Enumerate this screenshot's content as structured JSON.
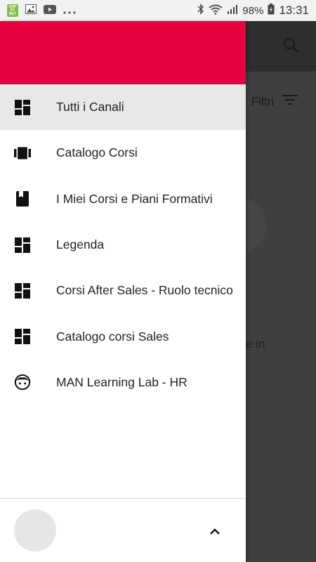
{
  "status_bar": {
    "happy_icon_text": "HAP PY BET",
    "battery_percent": "98%",
    "time": "13:31",
    "icons": [
      "happy-app-icon",
      "gallery-icon",
      "youtube-icon",
      "more-icon",
      "bluetooth-icon",
      "wifi-icon",
      "signal-icon",
      "battery-icon"
    ]
  },
  "background": {
    "filter_label": "Filtri",
    "partial_text": "e in"
  },
  "drawer": {
    "header_color": "#e5023d",
    "items": [
      {
        "label": "Tutti i Canali",
        "icon": "dashboard-icon",
        "active": true
      },
      {
        "label": "Catalogo Corsi",
        "icon": "carousel-icon",
        "active": false
      },
      {
        "label": "I Miei Corsi e Piani Formativi",
        "icon": "book-icon",
        "active": false
      },
      {
        "label": "Legenda",
        "icon": "dashboard-icon",
        "active": false
      },
      {
        "label": "Corsi After Sales - Ruolo tecnico",
        "icon": "dashboard-icon",
        "active": false
      },
      {
        "label": "Catalogo corsi Sales",
        "icon": "dashboard-icon",
        "active": false
      },
      {
        "label": "MAN Learning Lab - HR",
        "icon": "face-icon",
        "active": false
      }
    ]
  }
}
